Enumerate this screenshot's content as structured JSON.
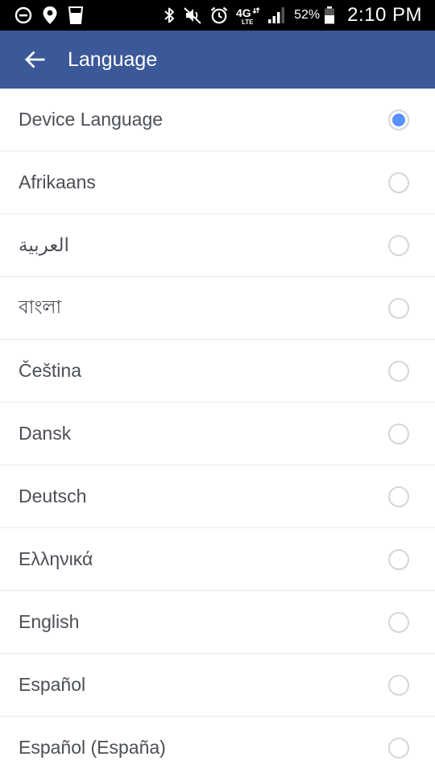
{
  "status_bar": {
    "left_icons": [
      "do-not-disturb-icon",
      "location-icon",
      "glass-icon"
    ],
    "right_icons": [
      "bluetooth-icon",
      "vibrate-off-icon",
      "alarm-icon",
      "network-4g-lte-icon",
      "signal-icon"
    ],
    "battery_percent": "52%",
    "time": "2:10 PM"
  },
  "app_bar": {
    "back_icon": "arrow-left-icon",
    "title": "Language",
    "color": "#3b5998"
  },
  "languages": [
    {
      "label": "Device Language",
      "selected": true
    },
    {
      "label": "Afrikaans",
      "selected": false
    },
    {
      "label": "العربية",
      "selected": false
    },
    {
      "label": "বাংলা",
      "selected": false
    },
    {
      "label": "Čeština",
      "selected": false
    },
    {
      "label": "Dansk",
      "selected": false
    },
    {
      "label": "Deutsch",
      "selected": false
    },
    {
      "label": "Ελληνικά",
      "selected": false
    },
    {
      "label": "English",
      "selected": false
    },
    {
      "label": "Español",
      "selected": false
    },
    {
      "label": "Español (España)",
      "selected": false
    }
  ],
  "colors": {
    "radio_selected": "#5890ff",
    "radio_border": "#d3d6db",
    "label_text": "#4b4f56"
  }
}
